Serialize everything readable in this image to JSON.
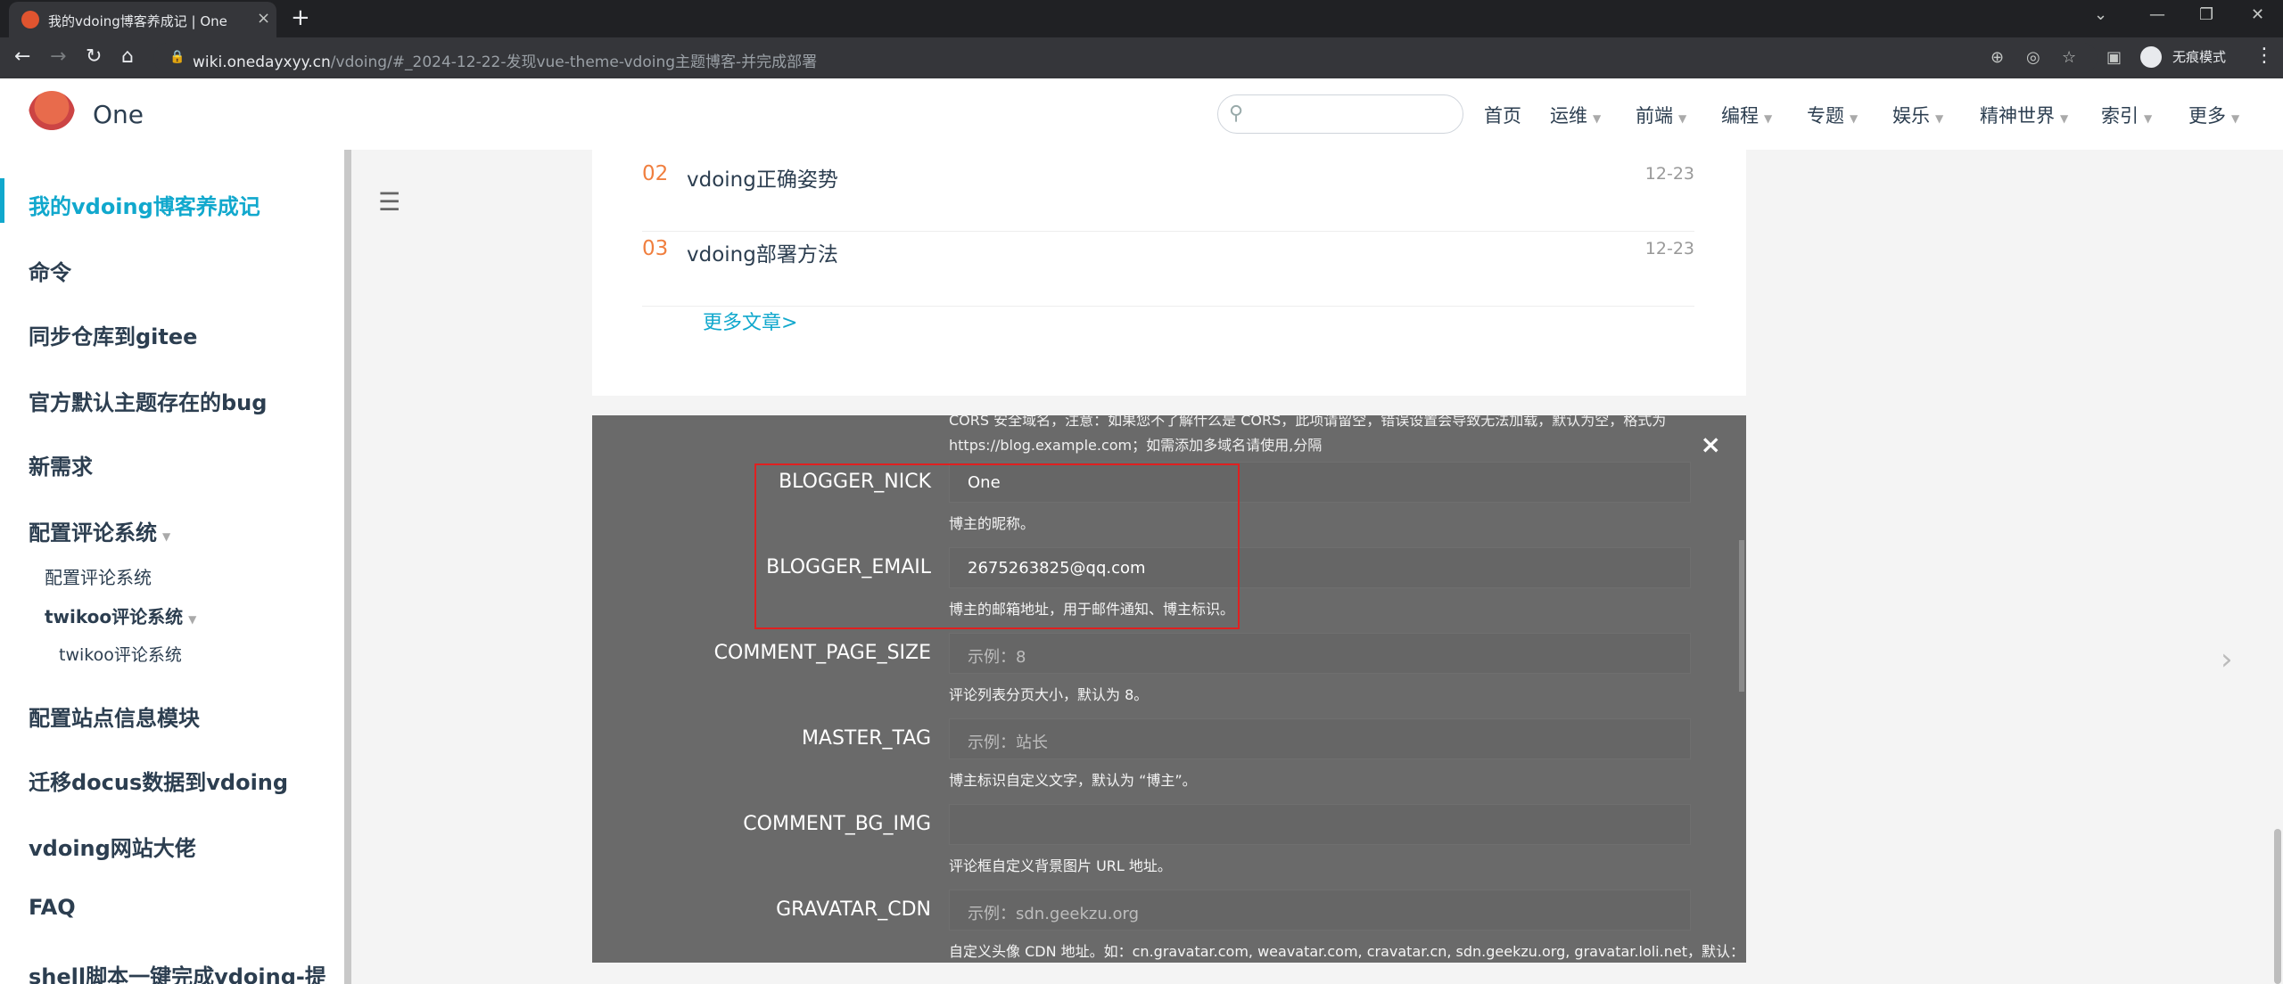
{
  "browser": {
    "tab_title": "我的vdoing博客养成记 | One",
    "tab_close": "×",
    "new_tab": "+",
    "url_host": "wiki.onedayxyy.cn",
    "url_path": "/vdoing/#_2024-12-22-发现vue-theme-vdoing主题博客-并完成部署",
    "incognito_label": "无痕模式"
  },
  "site": {
    "name": "One",
    "search_placeholder": "",
    "nav": [
      {
        "label": "首页",
        "dropdown": false
      },
      {
        "label": "运维",
        "dropdown": true
      },
      {
        "label": "前端",
        "dropdown": true
      },
      {
        "label": "编程",
        "dropdown": true
      },
      {
        "label": "专题",
        "dropdown": true
      },
      {
        "label": "娱乐",
        "dropdown": true
      },
      {
        "label": "精神世界",
        "dropdown": true
      },
      {
        "label": "索引",
        "dropdown": true
      },
      {
        "label": "更多",
        "dropdown": true
      }
    ]
  },
  "sidebar": {
    "items": [
      {
        "label": "我的vdoing博客养成记",
        "active": true
      },
      {
        "label": "命令"
      },
      {
        "label": "同步仓库到gitee"
      },
      {
        "label": "官方默认主题存在的bug"
      },
      {
        "label": "新需求"
      },
      {
        "label": "配置评论系统"
      },
      {
        "label": "配置站点信息模块"
      },
      {
        "label": "迁移docus数据到vdoing"
      },
      {
        "label": "vdoing网站大佬"
      },
      {
        "label": "FAQ"
      },
      {
        "label": "shell脚本一键完成vdoing-提"
      }
    ],
    "sub": {
      "comment_child": "配置评论系统",
      "twikoo_group": "twikoo评论系统",
      "twikoo_child": "twikoo评论系统"
    }
  },
  "articles": [
    {
      "num": "02",
      "title": "vdoing正确姿势",
      "date": "12-23"
    },
    {
      "num": "03",
      "title": "vdoing部署方法",
      "date": "12-23"
    }
  ],
  "more_articles": "更多文章>",
  "modal": {
    "close": "×",
    "top_hint": "CORS 安全域名，注意：如果您不了解什么是 CORS，此项请留空，错误设置会导致无法加载，默认为空，格式为 https://blog.example.com；如需添加多域名请使用,分隔",
    "fields": [
      {
        "label": "BLOGGER_NICK",
        "value": "One",
        "placeholder": "",
        "hint": "博主的昵称。"
      },
      {
        "label": "BLOGGER_EMAIL",
        "value": "2675263825@qq.com",
        "placeholder": "",
        "hint": "博主的邮箱地址，用于邮件通知、博主标识。"
      },
      {
        "label": "COMMENT_PAGE_SIZE",
        "value": "",
        "placeholder": "示例：8",
        "hint": "评论列表分页大小，默认为 8。"
      },
      {
        "label": "MASTER_TAG",
        "value": "",
        "placeholder": "示例：站长",
        "hint": "博主标识自定义文字，默认为 “博主”。"
      },
      {
        "label": "COMMENT_BG_IMG",
        "value": "",
        "placeholder": "",
        "hint": "评论框自定义背景图片 URL 地址。"
      },
      {
        "label": "GRAVATAR_CDN",
        "value": "",
        "placeholder": "示例：sdn.geekzu.org",
        "hint": "自定义头像 CDN 地址。如：cn.gravatar.com, weavatar.com, cravatar.cn, sdn.geekzu.org, gravatar.loli.net，默认："
      }
    ]
  },
  "colors": {
    "accent": "#11a8cd",
    "article_number": "#f07f3f",
    "highlight_box": "#e02020"
  }
}
